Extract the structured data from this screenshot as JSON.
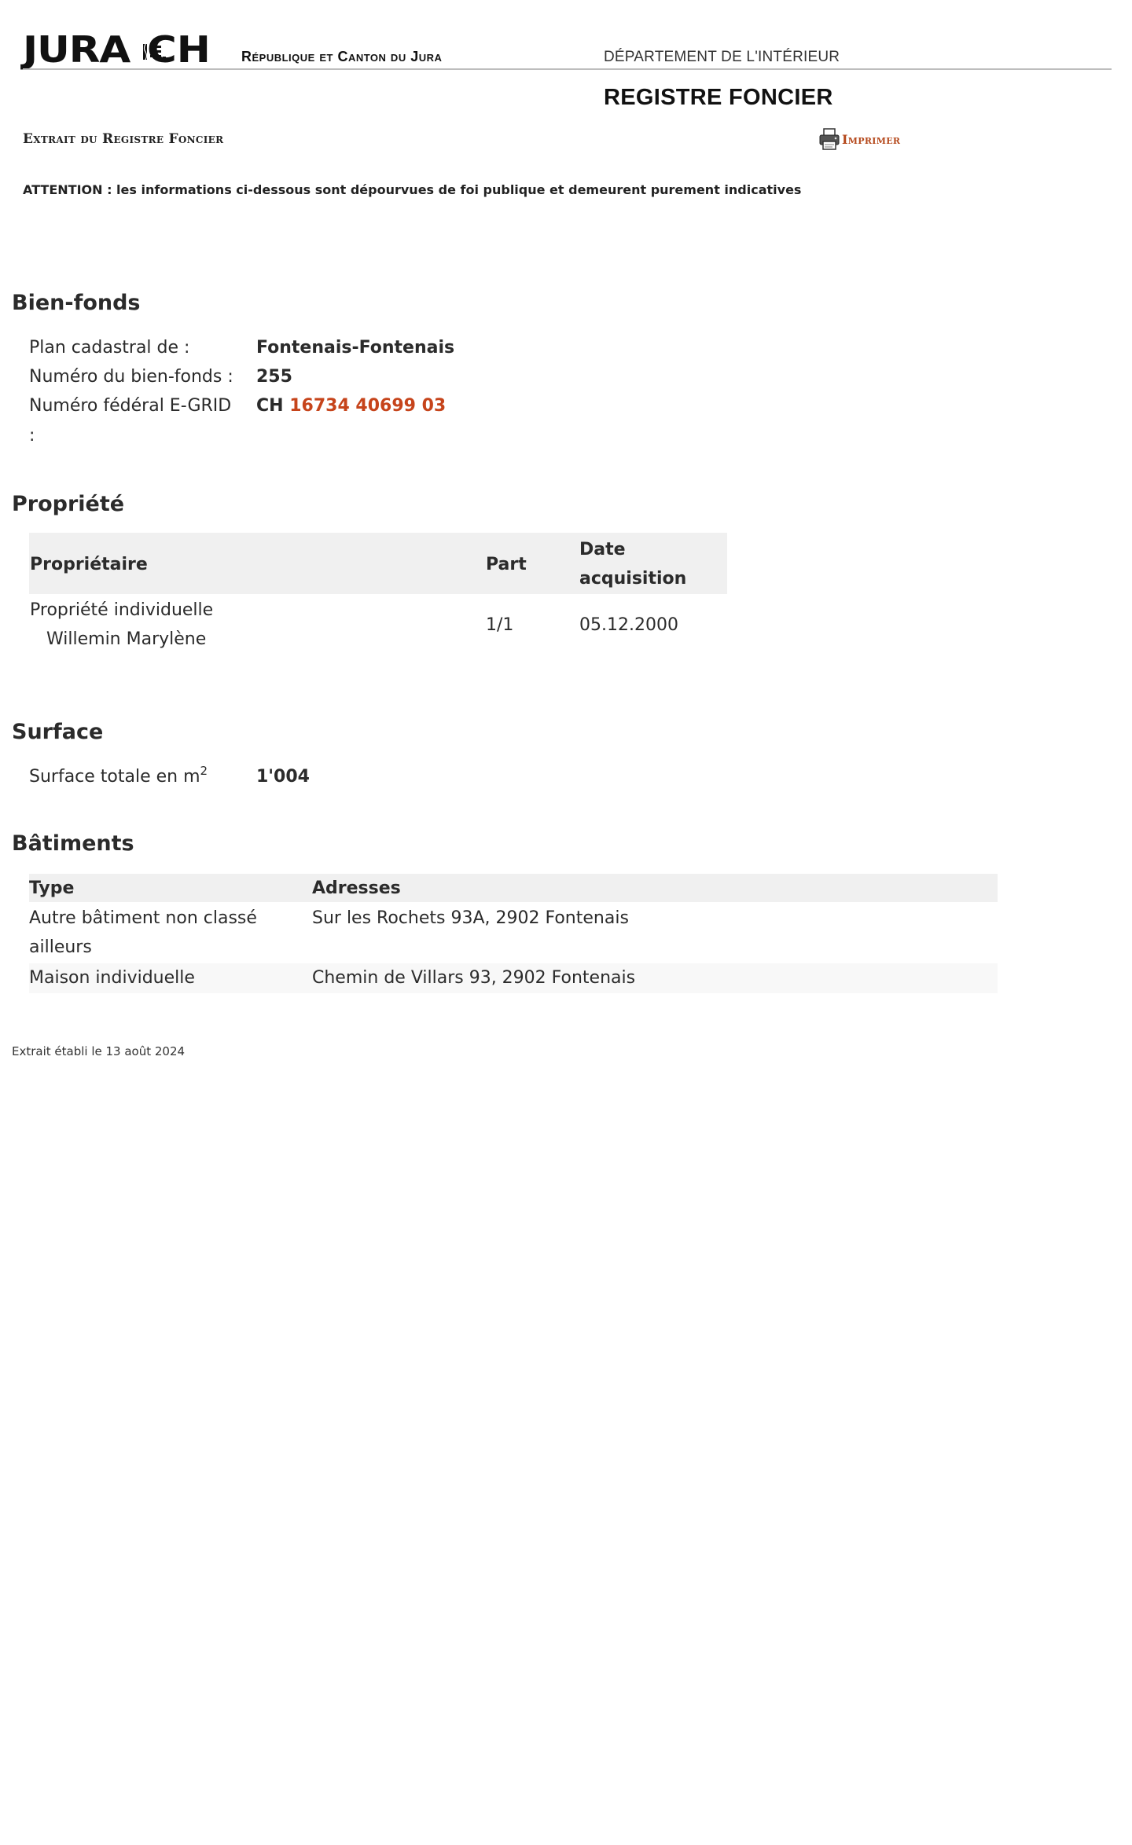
{
  "header": {
    "logo_word": "JURA",
    "logo_ch": "CH",
    "republique": "République et Canton du Jura",
    "departement": "DÉPARTEMENT DE L'INTÉRIEUR",
    "registre": "REGISTRE FONCIER",
    "extrait_title": "Extrait du Registre Foncier",
    "print_label": "Imprimer",
    "attention": "ATTENTION : les informations ci-dessous sont dépourvues de foi publique et demeurent purement indicatives"
  },
  "bienfonds": {
    "title": "Bien-fonds",
    "plan_label": "Plan cadastral de :",
    "plan_value": "Fontenais-Fontenais",
    "numero_label": "Numéro du bien-fonds :",
    "numero_value": "255",
    "egrid_label": "Numéro fédéral E-GRID",
    "egrid_label_colon": ":",
    "egrid_prefix": "CH",
    "egrid_number": "16734 40699 03"
  },
  "propriete": {
    "title": "Propriété",
    "columns": {
      "proprietaire": "Propriétaire",
      "part": "Part",
      "date_line1": "Date",
      "date_line2": "acquisition"
    },
    "rows": [
      {
        "type": "Propriété individuelle",
        "owner": "Willemin Marylène",
        "part": "1/1",
        "date": "05.12.2000"
      }
    ]
  },
  "surface": {
    "title": "Surface",
    "label": "Surface totale en m",
    "label_sup": "2",
    "value": "1'004"
  },
  "batiments": {
    "title": "Bâtiments",
    "columns": {
      "type": "Type",
      "adresses": "Adresses"
    },
    "rows": [
      {
        "type_line1": "Autre bâtiment non classé",
        "type_line2": "ailleurs",
        "address": "Sur les Rochets 93A, 2902 Fontenais"
      },
      {
        "type_line1": "Maison individuelle",
        "address": "Chemin de Villars 93, 2902 Fontenais"
      }
    ]
  },
  "footer": {
    "text": "Extrait établi le 13 août 2024"
  },
  "colors": {
    "accent": "#c6441b",
    "header_bg": "#f0f0f0",
    "text": "#2b2b2b"
  }
}
